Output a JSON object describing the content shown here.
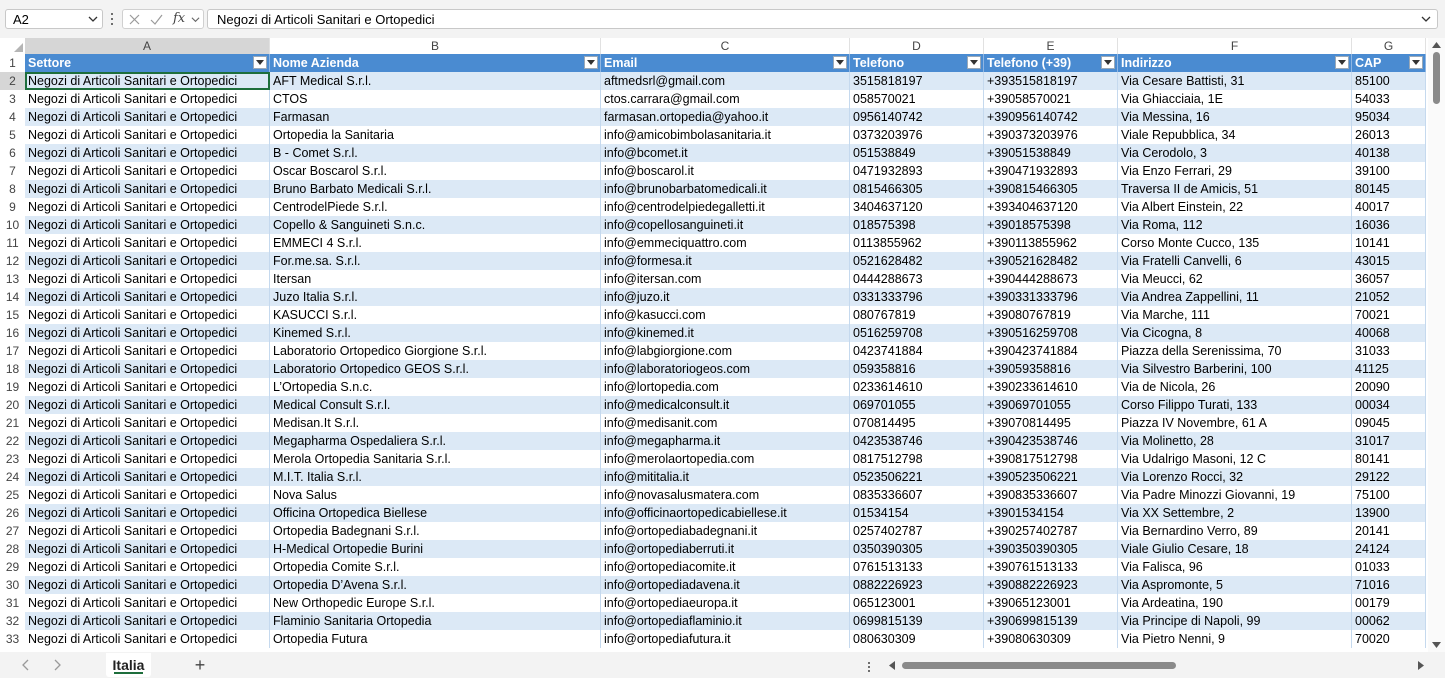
{
  "formula_bar": {
    "name_box": "A2",
    "fx_label": "fx",
    "formula": "Negozi di Articoli Sanitari e Ortopedici"
  },
  "columns": [
    "A",
    "B",
    "C",
    "D",
    "E",
    "F",
    "G"
  ],
  "table": {
    "headers": [
      "Settore",
      "Nome Azienda",
      "Email",
      "Telefono",
      "Telefono (+39)",
      "Indirizzo",
      "CAP"
    ],
    "rows": [
      [
        "Negozi di Articoli Sanitari e Ortopedici",
        "AFT Medical S.r.l.",
        "aftmedsrl@gmail.com",
        "3515818197",
        "+393515818197",
        "Via Cesare Battisti, 31",
        "85100"
      ],
      [
        "Negozi di Articoli Sanitari e Ortopedici",
        "CTOS",
        "ctos.carrara@gmail.com",
        "058570021",
        "+39058570021",
        "Via Ghiacciaia, 1E",
        "54033"
      ],
      [
        "Negozi di Articoli Sanitari e Ortopedici",
        "Farmasan",
        "farmasan.ortopedia@yahoo.it",
        "0956140742",
        "+390956140742",
        "Via Messina, 16",
        "95034"
      ],
      [
        "Negozi di Articoli Sanitari e Ortopedici",
        "Ortopedia la Sanitaria",
        "info@amicobimbolasanitaria.it",
        "0373203976",
        "+390373203976",
        "Viale Repubblica, 34",
        "26013"
      ],
      [
        "Negozi di Articoli Sanitari e Ortopedici",
        "B - Comet S.r.l.",
        "info@bcomet.it",
        "051538849",
        "+39051538849",
        "Via Cerodolo, 3",
        "40138"
      ],
      [
        "Negozi di Articoli Sanitari e Ortopedici",
        "Oscar Boscarol S.r.l.",
        "info@boscarol.it",
        "0471932893",
        "+390471932893",
        "Via Enzo Ferrari, 29",
        "39100"
      ],
      [
        "Negozi di Articoli Sanitari e Ortopedici",
        "Bruno Barbato Medicali S.r.l.",
        "info@brunobarbatomedicali.it",
        "0815466305",
        "+390815466305",
        "Traversa II de Amicis, 51",
        "80145"
      ],
      [
        "Negozi di Articoli Sanitari e Ortopedici",
        "CentrodelPiede S.r.l.",
        "info@centrodelpiedegalletti.it",
        "3404637120",
        "+393404637120",
        "Via Albert Einstein, 22",
        "40017"
      ],
      [
        "Negozi di Articoli Sanitari e Ortopedici",
        "Copello & Sanguineti S.n.c.",
        "info@copellosanguineti.it",
        "018575398",
        "+39018575398",
        "Via Roma, 112",
        "16036"
      ],
      [
        "Negozi di Articoli Sanitari e Ortopedici",
        "EMMECI 4 S.r.l.",
        "info@emmeciquattro.com",
        "0113855962",
        "+390113855962",
        "Corso Monte Cucco, 135",
        "10141"
      ],
      [
        "Negozi di Articoli Sanitari e Ortopedici",
        "For.me.sa. S.r.l.",
        "info@formesa.it",
        "0521628482",
        "+390521628482",
        "Via Fratelli Canvelli, 6",
        "43015"
      ],
      [
        "Negozi di Articoli Sanitari e Ortopedici",
        "Itersan",
        "info@itersan.com",
        "0444288673",
        "+390444288673",
        "Via Meucci, 62",
        "36057"
      ],
      [
        "Negozi di Articoli Sanitari e Ortopedici",
        "Juzo Italia S.r.l.",
        "info@juzo.it",
        "0331333796",
        "+390331333796",
        "Via Andrea Zappellini, 11",
        "21052"
      ],
      [
        "Negozi di Articoli Sanitari e Ortopedici",
        "KASUCCI S.r.l.",
        "info@kasucci.com",
        "080767819",
        "+39080767819",
        "Via Marche, 111",
        "70021"
      ],
      [
        "Negozi di Articoli Sanitari e Ortopedici",
        "Kinemed S.r.l.",
        "info@kinemed.it",
        "0516259708",
        "+390516259708",
        "Via Cicogna, 8",
        "40068"
      ],
      [
        "Negozi di Articoli Sanitari e Ortopedici",
        "Laboratorio Ortopedico Giorgione S.r.l.",
        "info@labgiorgione.com",
        "0423741884",
        "+390423741884",
        "Piazza della Serenissima, 70",
        "31033"
      ],
      [
        "Negozi di Articoli Sanitari e Ortopedici",
        "Laboratorio Ortopedico GEOS S.r.l.",
        "info@laboratoriogeos.com",
        "059358816",
        "+39059358816",
        "Via Silvestro Barberini, 100",
        "41125"
      ],
      [
        "Negozi di Articoli Sanitari e Ortopedici",
        "L’Ortopedia S.n.c.",
        "info@lortopedia.com",
        "0233614610",
        "+390233614610",
        "Via de Nicola, 26",
        "20090"
      ],
      [
        "Negozi di Articoli Sanitari e Ortopedici",
        "Medical Consult S.r.l.",
        "info@medicalconsult.it",
        "069701055",
        "+39069701055",
        "Corso Filippo Turati, 133",
        "00034"
      ],
      [
        "Negozi di Articoli Sanitari e Ortopedici",
        "Medisan.It S.r.l.",
        "info@medisanit.com",
        "070814495",
        "+39070814495",
        "Piazza IV Novembre, 61 A",
        "09045"
      ],
      [
        "Negozi di Articoli Sanitari e Ortopedici",
        "Megapharma Ospedaliera S.r.l.",
        "info@megapharma.it",
        "0423538746",
        "+390423538746",
        "Via Molinetto, 28",
        "31017"
      ],
      [
        "Negozi di Articoli Sanitari e Ortopedici",
        "Merola Ortopedia Sanitaria S.r.l.",
        "info@merolaortopedia.com",
        "0817512798",
        "+390817512798",
        "Via Udalrigo Masoni, 12 C",
        "80141"
      ],
      [
        "Negozi di Articoli Sanitari e Ortopedici",
        "M.I.T. Italia S.r.l.",
        "info@mititalia.it",
        "0523506221",
        "+390523506221",
        "Via Lorenzo Rocci, 32",
        "29122"
      ],
      [
        "Negozi di Articoli Sanitari e Ortopedici",
        "Nova Salus",
        "info@novasalusmatera.com",
        "0835336607",
        "+390835336607",
        "Via Padre Minozzi Giovanni, 19",
        "75100"
      ],
      [
        "Negozi di Articoli Sanitari e Ortopedici",
        "Officina Ortopedica Biellese",
        "info@officinaortopedicabiellese.it",
        "01534154",
        "+3901534154",
        "Via XX Settembre, 2",
        "13900"
      ],
      [
        "Negozi di Articoli Sanitari e Ortopedici",
        "Ortopedia Badegnani S.r.l.",
        "info@ortopediabadegnani.it",
        "0257402787",
        "+390257402787",
        "Via Bernardino Verro, 89",
        "20141"
      ],
      [
        "Negozi di Articoli Sanitari e Ortopedici",
        "H-Medical Ortopedie Burini",
        "info@ortopediaberruti.it",
        "0350390305",
        "+390350390305",
        "Viale Giulio Cesare, 18",
        "24124"
      ],
      [
        "Negozi di Articoli Sanitari e Ortopedici",
        "Ortopedia Comite S.r.l.",
        "info@ortopediacomite.it",
        "0761513133",
        "+390761513133",
        "Via Falisca, 96",
        "01033"
      ],
      [
        "Negozi di Articoli Sanitari e Ortopedici",
        "Ortopedia D’Avena S.r.l.",
        "info@ortopediadavena.it",
        "0882226923",
        "+390882226923",
        "Via Aspromonte, 5",
        "71016"
      ],
      [
        "Negozi di Articoli Sanitari e Ortopedici",
        "New Orthopedic Europe S.r.l.",
        "info@ortopediaeuropa.it",
        "065123001",
        "+39065123001",
        "Via Ardeatina, 190",
        "00179"
      ],
      [
        "Negozi di Articoli Sanitari e Ortopedici",
        "Flaminio Sanitaria Ortopedia",
        "info@ortopediaflaminio.it",
        "0699815139",
        "+390699815139",
        "Via Principe di Napoli, 99",
        "00062"
      ],
      [
        "Negozi di Articoli Sanitari e Ortopedici",
        "Ortopedia Futura",
        "info@ortopediafutura.it",
        "080630309",
        "+39080630309",
        "Via Pietro Nenni, 9",
        "70020"
      ]
    ]
  },
  "sheet_tabs": [
    "Italia"
  ],
  "add_sheet_label": "+",
  "colors": {
    "header_blue": "#4a8bd1",
    "band_blue": "#dce9f6",
    "selection_green": "#1e6e3c"
  }
}
